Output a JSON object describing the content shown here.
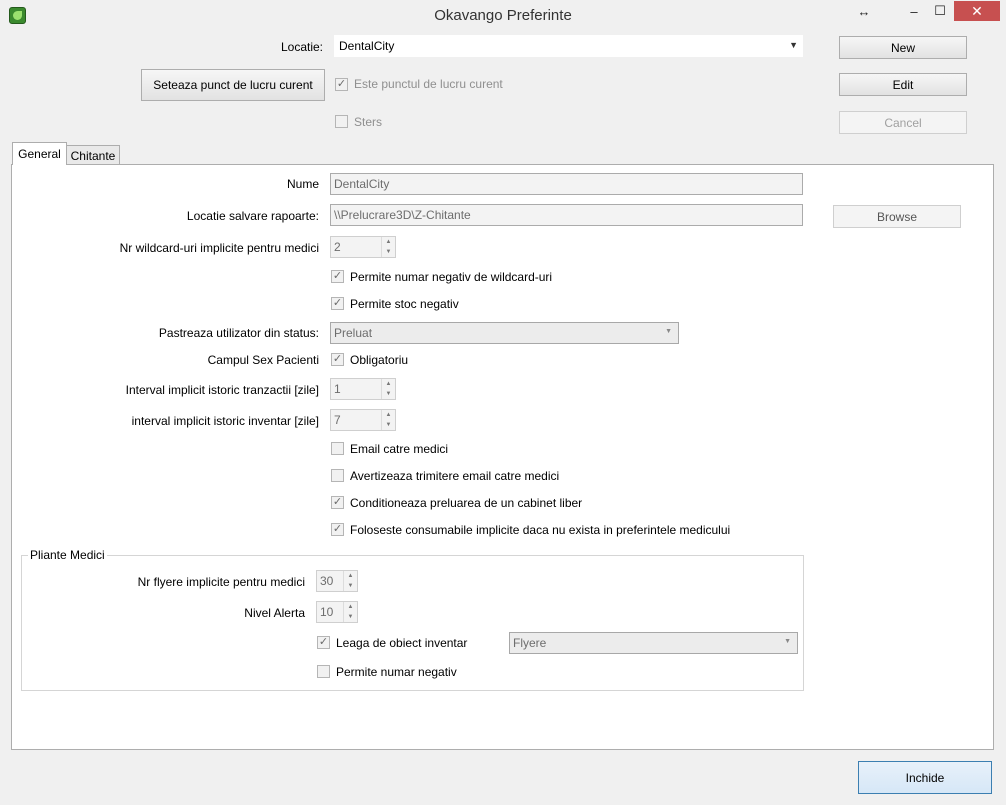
{
  "window": {
    "title": "Okavango Preferinte",
    "controls": {
      "resize": "↔",
      "minimize": "–",
      "maximize": "☐",
      "close": "✕"
    }
  },
  "header": {
    "location_label": "Locatie:",
    "location_value": "DentalCity",
    "set_current_button": "Seteaza punct de lucru curent",
    "is_current_label": "Este punctul de lucru curent",
    "is_current_checked": true,
    "deleted_label": "Sters",
    "deleted_checked": false,
    "new_button": "New",
    "edit_button": "Edit",
    "cancel_button": "Cancel"
  },
  "tabs": [
    {
      "label": "General",
      "active": true
    },
    {
      "label": "Chitante",
      "active": false
    }
  ],
  "general": {
    "name_label": "Nume",
    "name_value": "DentalCity",
    "save_location_label": "Locatie salvare rapoarte:",
    "save_location_value": "\\\\Prelucrare3D\\Z-Chitante",
    "browse_button": "Browse",
    "wildcards_label": "Nr wildcard-uri implicite pentru medici",
    "wildcards_value": "2",
    "allow_negative_wildcards_label": "Permite numar negativ de wildcard-uri",
    "allow_negative_wildcards_checked": true,
    "allow_negative_stock_label": "Permite stoc negativ",
    "allow_negative_stock_checked": true,
    "keep_user_label": "Pastreaza utilizator din status:",
    "keep_user_value": "Preluat",
    "sex_field_label": "Campul Sex Pacienti",
    "sex_field_option_label": "Obligatoriu",
    "sex_field_checked": true,
    "transaction_history_label": "Interval implicit istoric tranzactii [zile]",
    "transaction_history_value": "1",
    "inventory_history_label": "interval implicit istoric inventar [zile]",
    "inventory_history_value": "7",
    "email_doctors_label": "Email catre medici",
    "email_doctors_checked": false,
    "warn_email_label": "Avertizeaza trimitere email catre medici",
    "warn_email_checked": false,
    "condition_cabinet_label": "Conditioneaza preluarea de un cabinet liber",
    "condition_cabinet_checked": true,
    "default_consumables_label": "Foloseste consumabile implicite daca nu exista in preferintele medicului",
    "default_consumables_checked": true
  },
  "flyers_group": {
    "title": "Pliante Medici",
    "default_flyers_label": "Nr flyere implicite pentru medici",
    "default_flyers_value": "30",
    "alert_level_label": "Nivel Alerta",
    "alert_level_value": "10",
    "link_inventory_label": "Leaga de obiect inventar",
    "link_inventory_checked": true,
    "link_inventory_value": "Flyere",
    "allow_negative_label": "Permite numar negativ",
    "allow_negative_checked": false
  },
  "footer": {
    "close_button": "Inchide"
  }
}
